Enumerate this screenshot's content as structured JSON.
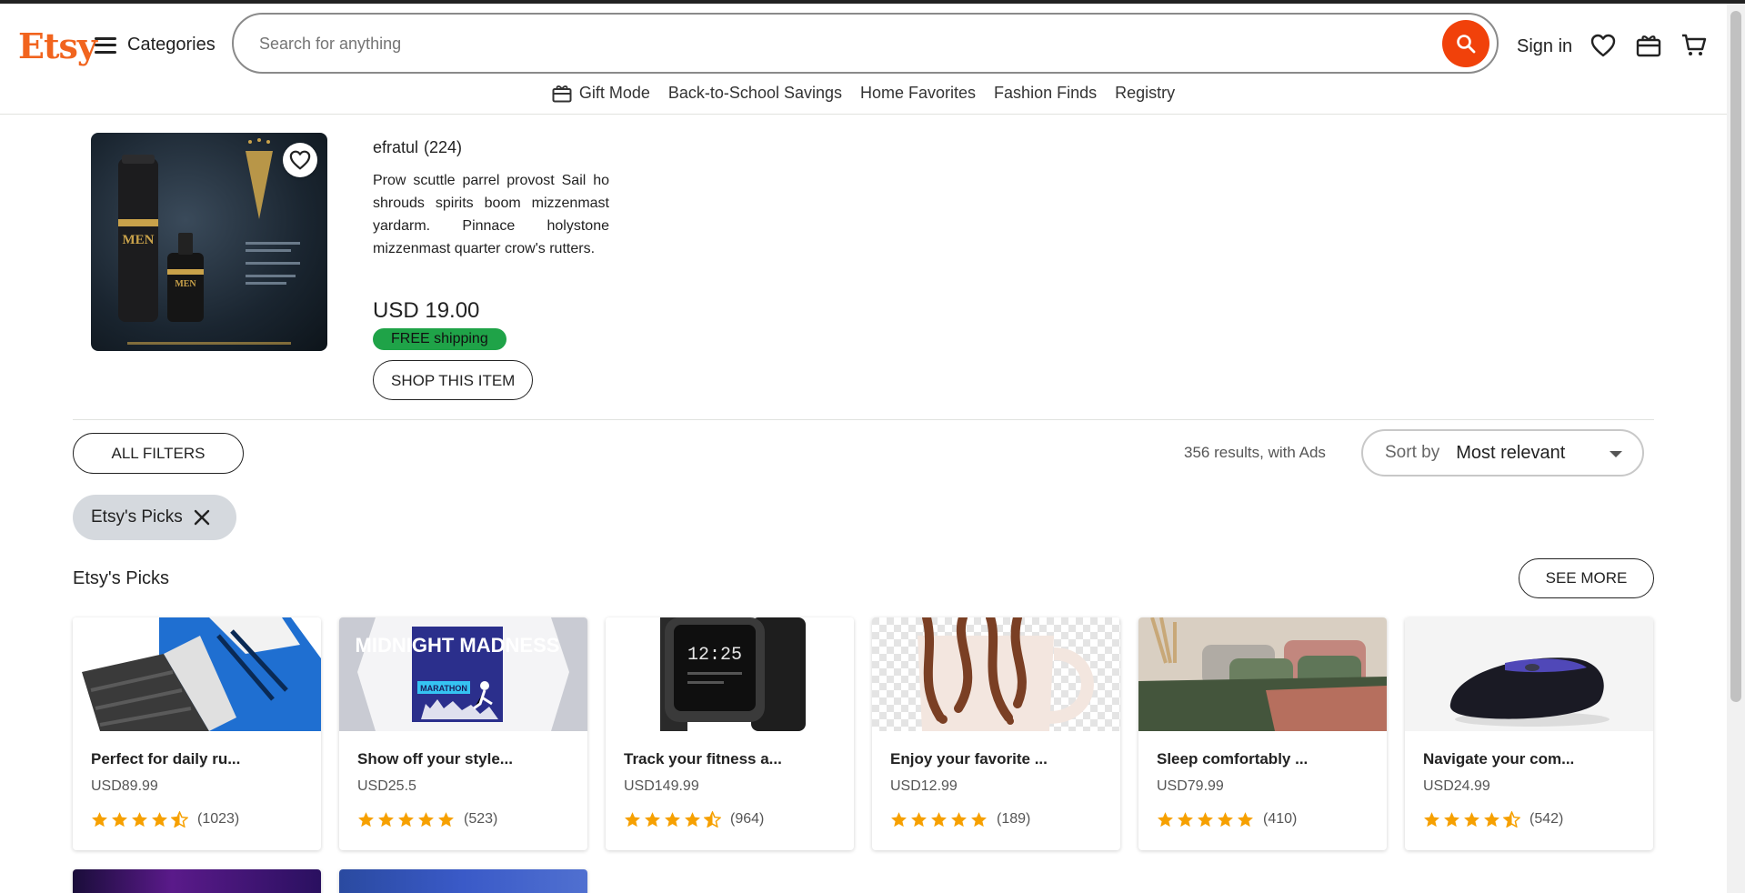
{
  "header": {
    "logo": "Etsy",
    "categories_label": "Categories",
    "search_placeholder": "Search for anything",
    "sign_in": "Sign in"
  },
  "subnav": {
    "gift_mode": "Gift Mode",
    "links": [
      "Back-to-School Savings",
      "Home Favorites",
      "Fashion Finds",
      "Registry"
    ]
  },
  "ad": {
    "seller": "efratul",
    "seller_count": "(224)",
    "description": "Prow scuttle parrel provost Sail ho shrouds spirits boom mizzenmast yardarm. Pinnace holystone mizzenmast quarter crow's rutters.",
    "price": "USD 19.00",
    "shipping": "FREE shipping",
    "shop_button": "SHOP THIS ITEM",
    "image_text": "MEN"
  },
  "filters": {
    "all_filters": "ALL FILTERS",
    "results": "356 results, with Ads",
    "sort_label": "Sort by",
    "sort_value": "Most relevant",
    "active_chip": "Etsy's Picks"
  },
  "section": {
    "title": "Etsy's Picks",
    "see_more": "SEE MORE"
  },
  "cards": [
    {
      "title": "Perfect for daily ru...",
      "price": "USD89.99",
      "rating": 4.5,
      "count": "(1023)",
      "image": "sneaker"
    },
    {
      "title": "Show off your style...",
      "price": "USD25.5",
      "rating": 5,
      "count": "(523)",
      "image": "tshirt",
      "image_text": "MIDNIGHT MADNESS",
      "image_subtext": "MARATHON"
    },
    {
      "title": "Track your fitness a...",
      "price": "USD149.99",
      "rating": 4.5,
      "count": "(964)",
      "image": "smartwatch",
      "image_text": "12:25"
    },
    {
      "title": "Enjoy your favorite ...",
      "price": "USD12.99",
      "rating": 5,
      "count": "(189)",
      "image": "mug"
    },
    {
      "title": "Sleep comfortably ...",
      "price": "USD79.99",
      "rating": 5,
      "count": "(410)",
      "image": "bedding"
    },
    {
      "title": "Navigate your com...",
      "price": "USD24.99",
      "rating": 4.5,
      "count": "(542)",
      "image": "mouse"
    }
  ],
  "colors": {
    "brand": "#f1641e",
    "search_button": "#f1410a",
    "star": "#f6a000",
    "free_shipping": "#1fa348",
    "chip": "#d5d9de"
  }
}
